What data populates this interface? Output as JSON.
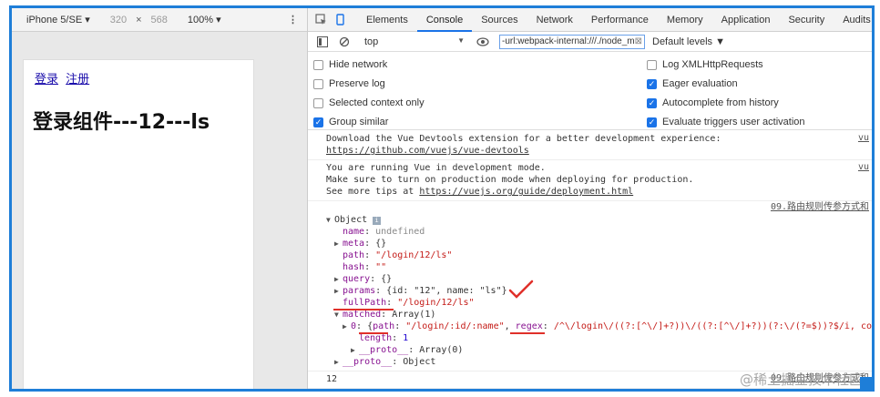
{
  "device_toolbar": {
    "device": "iPhone 5/SE ▾",
    "width": "320",
    "times": "×",
    "height": "568",
    "zoom": "100% ▾",
    "more": "⋮"
  },
  "page": {
    "link_login": "登录",
    "link_register": "注册",
    "heading": "登录组件---12---ls"
  },
  "tabs": [
    "Elements",
    "Console",
    "Sources",
    "Network",
    "Performance",
    "Memory",
    "Application",
    "Security",
    "Audits"
  ],
  "active_tab": "Console",
  "console_toolbar": {
    "context": "top",
    "context_arrow": "▼",
    "filter": "-url:webpack-internal:///./node_m",
    "levels": "Default levels ▼"
  },
  "settings": {
    "hide_network": "Hide network",
    "preserve_log": "Preserve log",
    "selected_context": "Selected context only",
    "group_similar": "Group similar",
    "log_xml": "Log XMLHttpRequests",
    "eager_eval": "Eager evaluation",
    "autocomplete": "Autocomplete from history",
    "evaluate_triggers": "Evaluate triggers user activation"
  },
  "messages": {
    "m1_text": "Download the Vue Devtools extension for a better development experience:",
    "m1_link": "https://github.com/vuejs/vue-devtools",
    "m1_src": "vu",
    "m2_l1": "You are running Vue in development mode.",
    "m2_l2": "Make sure to turn on production mode when deploying for production.",
    "m2_l3": "See more tips at ",
    "m2_link": "https://vuejs.org/guide/deployment.html",
    "m2_src": "vu",
    "obj_src": "09.路由规则传参方式和",
    "object_label": "Object",
    "name_key": "name",
    "name_val": "undefined",
    "meta_key": "meta",
    "meta_val": "{}",
    "path_key": "path",
    "path_val": "\"/login/12/ls\"",
    "hash_key": "hash",
    "hash_val": "\"\"",
    "query_key": "query",
    "query_val": "{}",
    "params_key": "params",
    "params_val": "{id: \"12\", name: \"ls\"}",
    "fullpath_key": "fullPath",
    "fullpath_val": "\"/login/12/ls\"",
    "matched_key": "matched",
    "matched_val": "Array(1)",
    "m0_key": "0",
    "m0_path_key": "path",
    "m0_path_val": "\"/login/:id/:name\"",
    "m0_regex_key": "regex",
    "m0_regex_val": "/^\\/login\\/((?:[^\\/]+?))\\/((?:[^\\/]+?))(?:\\/(?=$))?$/i, comp",
    "length_key": "length",
    "length_val": "1",
    "proto1_key": "__proto__",
    "proto1_val": "Array(0)",
    "proto2_key": "__proto__",
    "proto2_val": "Object",
    "num_12": "12",
    "num_src": "09.路由规则传参方式和",
    "prompt": "›"
  },
  "watermark": "@稀土掘金技术社区"
}
